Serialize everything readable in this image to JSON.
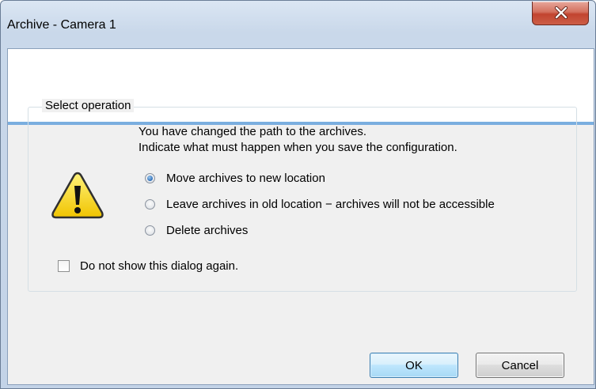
{
  "window": {
    "title": "Archive - Camera 1"
  },
  "group": {
    "legend": "Select operation",
    "message_line1": "You have changed the path to the archives.",
    "message_line2": "Indicate what must happen when you save the configuration."
  },
  "options": [
    {
      "label": "Move archives to new location",
      "selected": true
    },
    {
      "label": "Leave archives in old location − archives will not be accessible",
      "selected": false
    },
    {
      "label": "Delete archives",
      "selected": false
    }
  ],
  "checkbox": {
    "label": "Do not show this dialog again.",
    "checked": false
  },
  "buttons": {
    "ok": "OK",
    "cancel": "Cancel"
  },
  "icons": {
    "warning": "warning-icon",
    "close": "close-icon"
  },
  "colors": {
    "accent_line": "#7aaedf",
    "close_button": "#c2442f",
    "warning_yellow": "#f7d51d"
  }
}
